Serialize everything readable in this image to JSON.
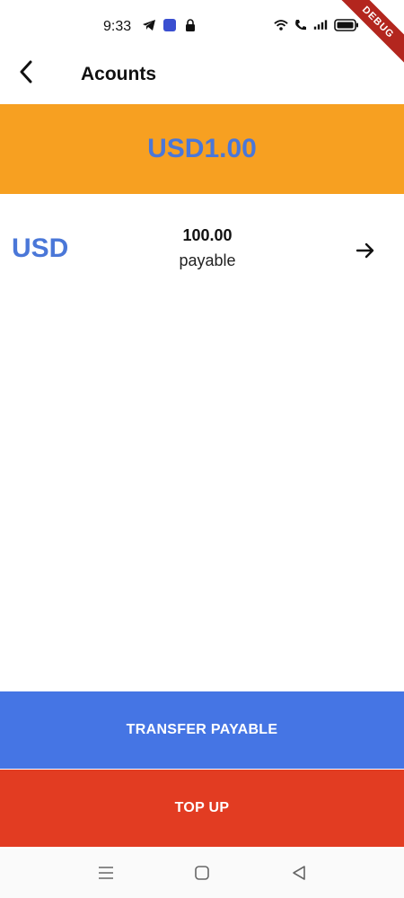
{
  "status_bar": {
    "time": "9:33",
    "left_icons": [
      "telegram-icon",
      "app-notification-icon",
      "lock-bag-icon"
    ],
    "right_icons": [
      "wifi-icon",
      "call-icon",
      "signal-icon",
      "battery-icon"
    ]
  },
  "debug_banner": {
    "label": "DEBUG"
  },
  "app_bar": {
    "title": "Acounts",
    "back_icon": "chevron-left-icon"
  },
  "balance_banner": {
    "text": "USD1.00",
    "background": "#f7a021",
    "text_color": "#4a77d8"
  },
  "accounts": [
    {
      "currency": "USD",
      "amount": "100.00",
      "status": "payable",
      "action_icon": "arrow-right-icon"
    }
  ],
  "actions": {
    "transfer_label": "TRANSFER PAYABLE",
    "transfer_color": "#4575e4",
    "topup_label": "TOP UP",
    "topup_color": "#e23c22"
  },
  "nav_bar": {
    "icons": [
      "menu-icon",
      "home-icon",
      "back-icon"
    ]
  }
}
